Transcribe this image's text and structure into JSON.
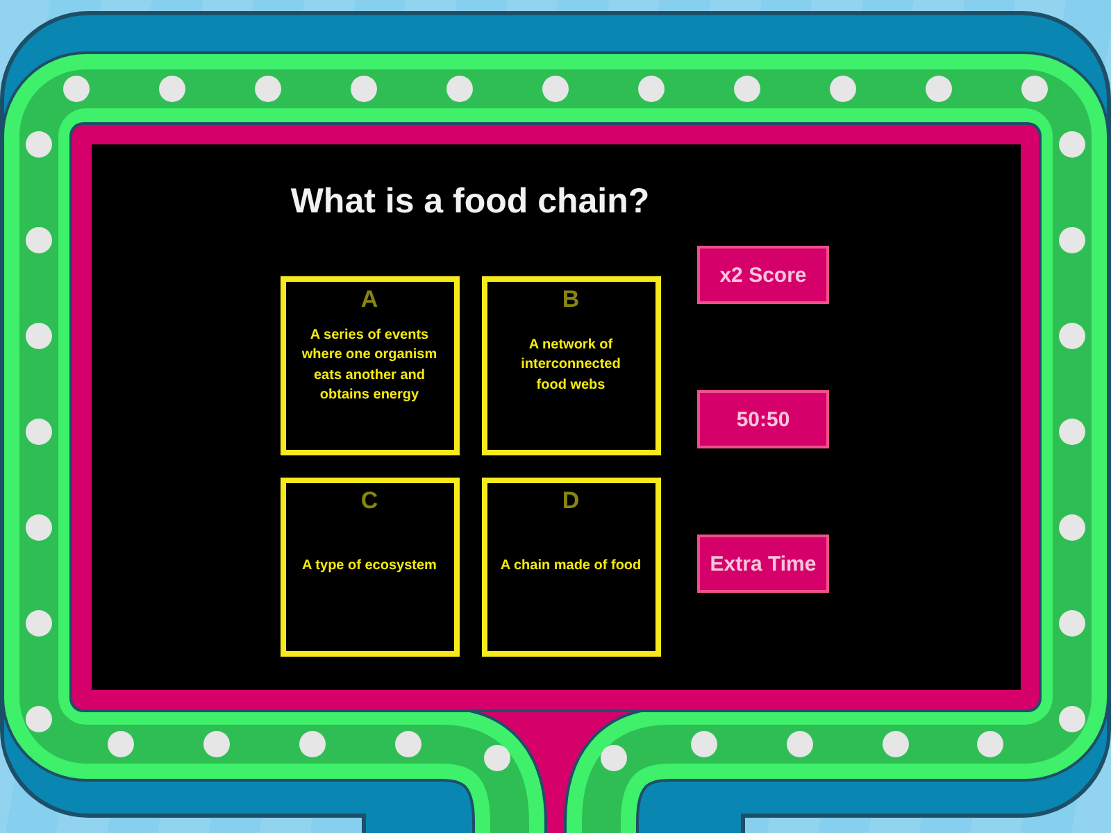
{
  "question": "What is a food chain?",
  "answers": [
    {
      "letter": "A",
      "text": "A series of events where one organism eats another and obtains energy"
    },
    {
      "letter": "B",
      "text": "A network of interconnected food webs"
    },
    {
      "letter": "C",
      "text": "A type of ecosystem"
    },
    {
      "letter": "D",
      "text": "A chain made of food"
    }
  ],
  "power_ups": [
    {
      "label": "x2 Score"
    },
    {
      "label": "50:50"
    },
    {
      "label": "Extra Time"
    }
  ]
}
